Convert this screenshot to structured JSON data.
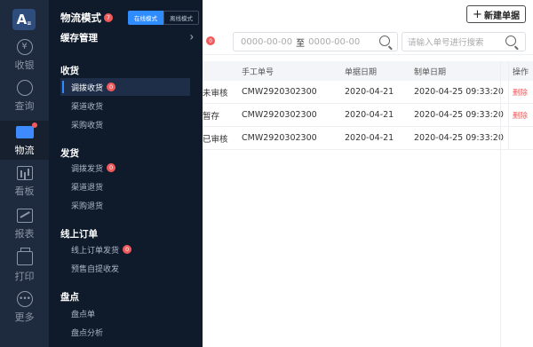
{
  "toolbar": {
    "new_label": "新建单据",
    "new_icon": "plus-icon"
  },
  "filter": {
    "badge": "0",
    "date_from": "0000-00-00",
    "date_sep": "至",
    "date_to": "0000-00-00",
    "search_placeholder": "请输入单号进行搜索"
  },
  "table": {
    "headers": [
      "手工单号",
      "单据日期",
      "制单日期",
      "操作"
    ],
    "rows": [
      {
        "status": "未审核",
        "manual_no": "CMW2920302300",
        "doc_date": "2020-04-21",
        "make_date": "2020-04-25 09:33:20",
        "action": "删除"
      },
      {
        "status": "暂存",
        "manual_no": "CMW2920302300",
        "doc_date": "2020-04-21",
        "make_date": "2020-04-25 09:33:20",
        "action": "删除"
      },
      {
        "status": "已审核",
        "manual_no": "CMW2920302300",
        "doc_date": "2020-04-21",
        "make_date": "2020-04-25 09:33:20",
        "action": ""
      }
    ]
  },
  "rail": {
    "logo": "A",
    "logo_sub": "≡",
    "items": [
      {
        "label": "收银",
        "icon": "yen-icon"
      },
      {
        "label": "查询",
        "icon": "search-icon"
      },
      {
        "label": "物流",
        "icon": "truck-icon"
      },
      {
        "label": "看板",
        "icon": "dashboard-icon"
      },
      {
        "label": "报表",
        "icon": "report-icon"
      },
      {
        "label": "打印",
        "icon": "printer-icon"
      },
      {
        "label": "更多",
        "icon": "more-icon"
      }
    ]
  },
  "panel": {
    "title": "物流模式",
    "title_badge": "7",
    "mode_online": "在线模式",
    "mode_offline": "离线模式",
    "cache_label": "缓存管理",
    "groups": [
      {
        "title": "收货",
        "items": [
          {
            "label": "调拨收货",
            "badge": "0"
          },
          {
            "label": "渠道收货",
            "badge": ""
          },
          {
            "label": "采购收货",
            "badge": ""
          }
        ]
      },
      {
        "title": "发货",
        "items": [
          {
            "label": "调拨发货",
            "badge": "0"
          },
          {
            "label": "渠道退货",
            "badge": ""
          },
          {
            "label": "采购退货",
            "badge": ""
          }
        ]
      },
      {
        "title": "线上订单",
        "items": [
          {
            "label": "线上订单发货",
            "badge": "0"
          },
          {
            "label": "预售自提收发",
            "badge": ""
          }
        ]
      },
      {
        "title": "盘点",
        "items": [
          {
            "label": "盘点单",
            "badge": ""
          },
          {
            "label": "盘点分析",
            "badge": ""
          }
        ]
      }
    ]
  },
  "colors": {
    "accent": "#2f8cff",
    "danger": "#f05a5a",
    "rail_bg": "#1e2b3e",
    "panel_bg": "#0f1a2b"
  }
}
